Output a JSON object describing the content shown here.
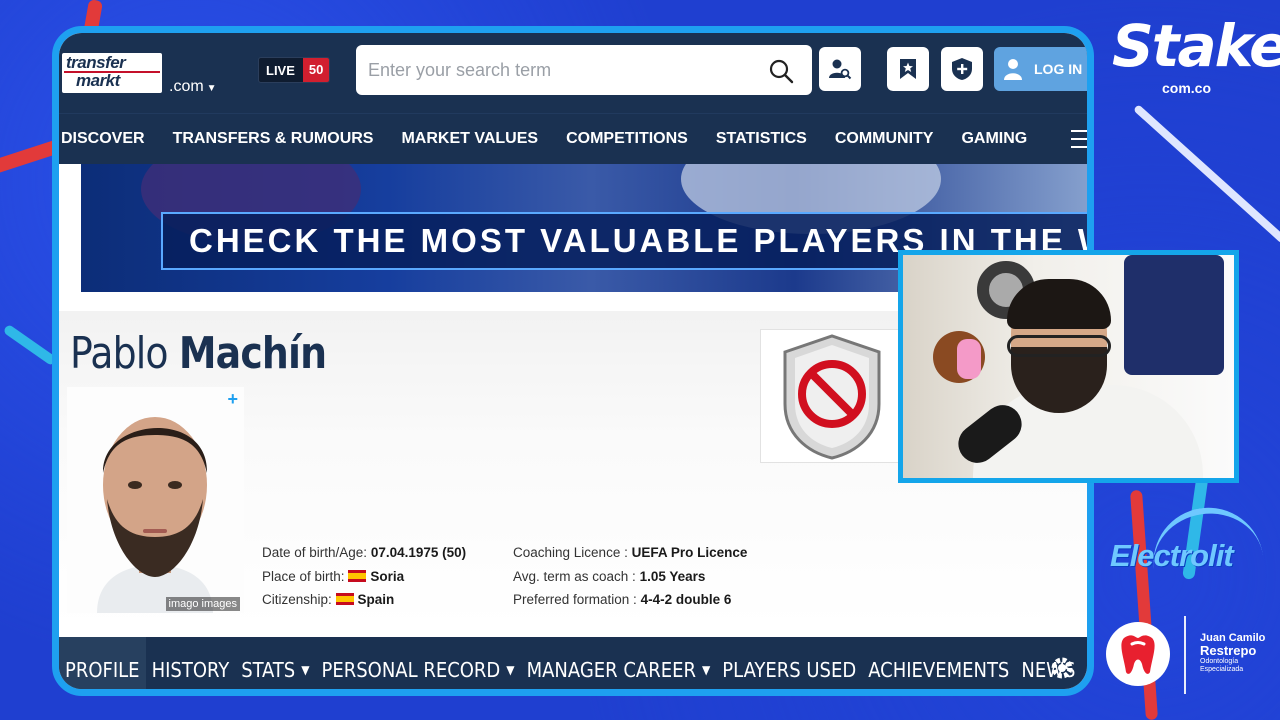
{
  "colors": {
    "tm_navy": "#1a3151",
    "frame_blue": "#1ea0f0",
    "live_red": "#d11f2f",
    "login_blue": "#5fa3e0",
    "bg_blue": "#1f3fd0"
  },
  "header": {
    "logo_line1": "transfer",
    "logo_line2": "markt",
    "domain": ".com",
    "live_label": "LIVE",
    "live_count": "50",
    "search_placeholder": "Enter your search term",
    "login_label": "LOG IN"
  },
  "nav": {
    "items": [
      "DISCOVER",
      "TRANSFERS & RUMOURS",
      "MARKET VALUES",
      "COMPETITIONS",
      "STATISTICS",
      "COMMUNITY",
      "GAMING"
    ]
  },
  "banner": {
    "text": "CHECK THE MOST VALUABLE PLAYERS IN THE WO"
  },
  "profile": {
    "first_name": "Pablo",
    "last_name": "Machín",
    "photo_credit": "imago images",
    "dob_label": "Date of birth/Age:",
    "dob_value": "07.04.1975 (50)",
    "pob_label": "Place of birth:",
    "pob_value": "Soria",
    "citizenship_label": "Citizenship:",
    "citizenship_value": "Spain",
    "licence_label": "Coaching Licence :",
    "licence_value": "UEFA Pro Licence",
    "term_label": "Avg. term as coach :",
    "term_value": "1.05 Years",
    "formation_label": "Preferred formation :",
    "formation_value": "4-4-2 double 6"
  },
  "subnav": {
    "items": [
      {
        "label": "PROFILE",
        "dropdown": false
      },
      {
        "label": "HISTORY",
        "dropdown": false
      },
      {
        "label": "STATS",
        "dropdown": true
      },
      {
        "label": "PERSONAL RECORD",
        "dropdown": true
      },
      {
        "label": "MANAGER CAREER",
        "dropdown": true
      },
      {
        "label": "PLAYERS USED",
        "dropdown": false
      },
      {
        "label": "ACHIEVEMENTS",
        "dropdown": false
      },
      {
        "label": "NEWS",
        "dropdown": false
      }
    ]
  },
  "sponsors": {
    "stake": "Stake",
    "stake_domain": "com.co",
    "electrolit": "Electrolit",
    "dentist_line1": "Juan Camilo",
    "dentist_line2": "Restrepo",
    "dentist_line3": "Odontología",
    "dentist_line4": "Especializada"
  }
}
